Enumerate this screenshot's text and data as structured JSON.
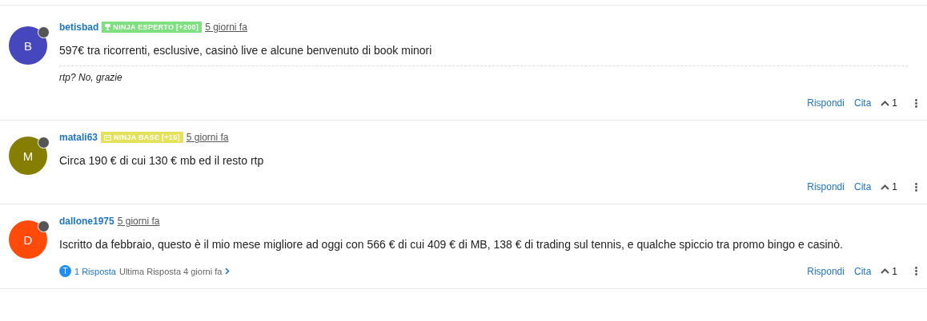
{
  "posts": [
    {
      "avatar": {
        "letter": "B",
        "color": "#4646bd"
      },
      "author": "betisbad",
      "badge": {
        "kind": "trophy",
        "label": "NINJA ESPERTO [+200]",
        "color": "#7ee07e"
      },
      "time": "5 giorni fa",
      "text": "597€ tra ricorrenti, esclusive, casinò live e alcune benvenuto di book minori",
      "signature": "rtp? No, grazie",
      "actions": {
        "reply": "Rispondi",
        "quote": "Cita",
        "votes": "1"
      }
    },
    {
      "avatar": {
        "letter": "M",
        "color": "#857e00"
      },
      "author": "matali63",
      "badge": {
        "kind": "card",
        "label": "NINJA BASE [+15]",
        "color": "#e3e25a"
      },
      "time": "5 giorni fa",
      "text": "Circa 190 € di cui 130 € mb ed il resto rtp",
      "actions": {
        "reply": "Rispondi",
        "quote": "Cita",
        "votes": "1"
      }
    },
    {
      "avatar": {
        "letter": "D",
        "color": "#ff4b0a"
      },
      "author": "dallone1975",
      "time": "5 giorni fa",
      "text": "Iscritto da febbraio, questo è il mio mese migliore ad oggi con 566 € di cui 409 € di MB, 138 € di trading sul tennis, e qualche spiccio tra promo bingo e casinò.",
      "replies": {
        "avatar_letter": "T",
        "count": "1 Risposta",
        "last": "Ultima Risposta 4 giorni fa"
      },
      "actions": {
        "reply": "Rispondi",
        "quote": "Cita",
        "votes": "1"
      }
    }
  ]
}
